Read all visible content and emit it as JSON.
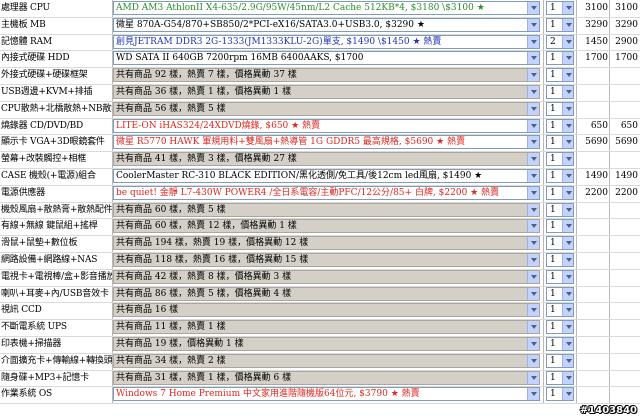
{
  "rows": [
    {
      "name": "處理器 CPU",
      "text": "AMD AM3 AthlonII X4-635/2.9G/95W/45nm/L2 Cache 512KB*4, $3180 \\$3100",
      "tail": "★",
      "color": "green",
      "gray": false,
      "qty": "1",
      "price": "3100",
      "total": "3100"
    },
    {
      "name": "主機板 MB",
      "text": "微星 870A-G54/870+SB850/2*PCI-eX16/SATA3.0+USB3.0, $3290",
      "tail": "★",
      "color": "black",
      "gray": false,
      "qty": "1",
      "price": "3290",
      "total": "3290"
    },
    {
      "name": "記憶體 RAM",
      "text": "創見JETRAM DDR3 2G-1333(JM1333KLU-2G)單支, $1490 \\$1450",
      "tail": "★ 熱賣",
      "color": "blue",
      "gray": false,
      "qty": "2",
      "price": "1450",
      "total": "2900"
    },
    {
      "name": "內接式硬碟 HDD",
      "text": "WD SATA II 640GB 7200rpm 16MB 6400AAKS, $1700",
      "tail": "",
      "color": "black",
      "gray": false,
      "qty": "1",
      "price": "1700",
      "total": "1700"
    },
    {
      "name": "外接式硬碟+硬碟框架",
      "text": "共有商品 92 樣，熱賣 7 樣，價格異動 37 樣",
      "tail": "",
      "color": "black",
      "gray": true,
      "qty": "1",
      "price": "",
      "total": ""
    },
    {
      "name": "USB週邊+KVM+排插",
      "text": "共有商品 36 樣，熱賣 1 樣，價格異動 1 樣",
      "tail": "",
      "color": "black",
      "gray": true,
      "qty": "1",
      "price": "",
      "total": ""
    },
    {
      "name": "CPU散熱+北橋散熱+NB散熱",
      "text": "共有商品 56 樣，熱賣 5 樣",
      "tail": "",
      "color": "black",
      "gray": true,
      "qty": "1",
      "price": "",
      "total": ""
    },
    {
      "name": "燒錄器 CD/DVD/BD",
      "text": "LITE-ON iHAS324/24XDVD燒錄, $650",
      "tail": "★ 熱賣",
      "color": "red",
      "gray": false,
      "qty": "1",
      "price": "650",
      "total": "650"
    },
    {
      "name": "顯示卡 VGA+3D眼鏡套件",
      "text": "微星 R5770 HAWK 軍規用料+雙風扇+熱導管 1G GDDR5 最高規格, $5690",
      "tail": "★ 熱賣",
      "color": "red",
      "gray": false,
      "qty": "1",
      "price": "5690",
      "total": "5690"
    },
    {
      "name": "螢幕+改裝觸控+相框",
      "text": "共有商品 41 樣，熱賣 3 樣，價格異動 27 樣",
      "tail": "",
      "color": "black",
      "gray": true,
      "qty": "1",
      "price": "",
      "total": ""
    },
    {
      "name": "CASE 機殼(+電源)組合",
      "text": "CoolerMaster RC-310 BLACK EDITION/黑化透側/免工具/後12cm led風扇, $1490",
      "tail": "★",
      "color": "black",
      "gray": false,
      "qty": "1",
      "price": "1490",
      "total": "1490"
    },
    {
      "name": "電源供應器",
      "text": "be quiet! 金靜 L7-430W POWER4 /全日系電容/主動PFC/12公分/85+ 白牌, $2200",
      "tail": "★ 熱賣",
      "color": "red",
      "gray": false,
      "qty": "1",
      "price": "2200",
      "total": "2200"
    },
    {
      "name": "機殼風扇+散熱膏+散熱配件",
      "text": "共有商品 60 樣，熱賣 5 樣",
      "tail": "",
      "color": "black",
      "gray": true,
      "qty": "1",
      "price": "",
      "total": ""
    },
    {
      "name": "有線+無線 鍵鼠組+搖桿",
      "text": "共有商品 60 樣，熱賣 12 樣，價格異動 1 樣",
      "tail": "",
      "color": "black",
      "gray": true,
      "qty": "1",
      "price": "",
      "total": ""
    },
    {
      "name": "滑鼠+鼠墊+數位板",
      "text": "共有商品 194 樣，熱賣 19 樣，價格異動 12 樣",
      "tail": "",
      "color": "black",
      "gray": true,
      "qty": "1",
      "price": "",
      "total": ""
    },
    {
      "name": "網路設備+網路線+NAS",
      "text": "共有商品 118 樣，熱賣 16 樣，價格異動 15 樣",
      "tail": "",
      "color": "black",
      "gray": true,
      "qty": "1",
      "price": "",
      "total": ""
    },
    {
      "name": "電視卡+電視棒/盒+影音播放",
      "text": "共有商品 42 樣，熱賣 8 樣，價格異動 3 樣",
      "tail": "",
      "color": "black",
      "gray": true,
      "qty": "1",
      "price": "",
      "total": ""
    },
    {
      "name": "喇叭+耳麥+內/USB音效卡",
      "text": "共有商品 86 樣，熱賣 5 樣，價格異動 4 樣",
      "tail": "",
      "color": "black",
      "gray": true,
      "qty": "1",
      "price": "",
      "total": ""
    },
    {
      "name": "視訊 CCD",
      "text": "共有商品 16 樣",
      "tail": "",
      "color": "black",
      "gray": true,
      "qty": "1",
      "price": "",
      "total": ""
    },
    {
      "name": "不斷電系統 UPS",
      "text": "共有商品 11 樣，熱賣 1 樣",
      "tail": "",
      "color": "black",
      "gray": true,
      "qty": "1",
      "price": "",
      "total": ""
    },
    {
      "name": "印表機+掃描器",
      "text": "共有商品 19 樣，價格異動 1 樣",
      "tail": "",
      "color": "black",
      "gray": true,
      "qty": "1",
      "price": "",
      "total": ""
    },
    {
      "name": "介面擴充卡+傳輸線+轉換頭",
      "text": "共有商品 34 樣，熱賣 2 樣",
      "tail": "",
      "color": "black",
      "gray": true,
      "qty": "1",
      "price": "",
      "total": ""
    },
    {
      "name": "隨身碟+MP3+記憶卡",
      "text": "共有商品 31 樣，熱賣 1 樣，價格異動 6 樣",
      "tail": "",
      "color": "black",
      "gray": true,
      "qty": "1",
      "price": "",
      "total": ""
    },
    {
      "name": "作業系統 OS",
      "text": "Windows 7 Home Premium 中文家用進階隨機版64位元, $3790",
      "tail": "★ 熱賣",
      "color": "red",
      "gray": false,
      "qty": "1",
      "price": "",
      "total": ""
    }
  ],
  "watermark": "#1403840",
  "colors": {
    "green": "#2c8d2c",
    "blue": "#2236b3",
    "red": "#e0261e",
    "border": "#7f9db9",
    "gray": "#d4d0c8"
  }
}
